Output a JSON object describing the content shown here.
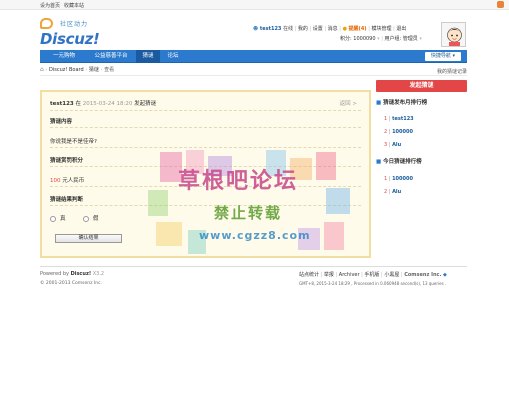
{
  "topbar": {
    "set_home": "设为首页",
    "bookmark": "收藏本站"
  },
  "logo": {
    "sub": "社区动力",
    "main": "Discuz!"
  },
  "user": {
    "name": "test123",
    "online": "在线",
    "links": [
      "我的",
      "设置",
      "消息"
    ],
    "reminder": "提醒(4)",
    "mod": "模块管理",
    "logout": "退出",
    "credits_label": "积分: 1000090",
    "group_label": "用户组: 管理员"
  },
  "nav": {
    "items": [
      "一元购物",
      "公益慈善平台",
      "猜谜",
      "论坛"
    ],
    "active_index": 2,
    "quick": "快捷导航 ▾"
  },
  "breadcrumb": {
    "home": "Discuz! Board",
    "section": "猜谜",
    "page": "查看"
  },
  "my_records": "我的猜谜记录",
  "post": {
    "author": "test123",
    "at": "在",
    "datetime": "2015-03-24 18:20",
    "action": "发起猜谜",
    "back": "返回 >",
    "content_title": "猜谜内容",
    "content": "你说我是不是佳帝?",
    "reward_title": "猜谜赏罚积分",
    "reward_value": "100",
    "reward_unit": "元人民币",
    "judge_title": "猜谜结果判断",
    "option_true": "真",
    "option_false": "假",
    "submit": "确认结果"
  },
  "sidebar": {
    "launch": "发起猜谜",
    "month_title": "猜谜发布月排行榜",
    "month_list": [
      {
        "rank": "1",
        "name": "test123"
      },
      {
        "rank": "2",
        "name": "100000"
      },
      {
        "rank": "3",
        "name": "Alu"
      }
    ],
    "today_title": "今日猜谜排行榜",
    "today_list": [
      {
        "rank": "1",
        "name": "100000"
      },
      {
        "rank": "2",
        "name": "Alu"
      }
    ]
  },
  "watermark": {
    "line1": "草根吧论坛",
    "line2": "禁止转载",
    "line3": "www.cgzz8.com"
  },
  "footer": {
    "powered": "Powered by",
    "brand": "Discuz!",
    "version": "X3.2",
    "copyright": "© 2001-2013 Comsenz Inc.",
    "links": [
      "站点统计",
      "举报",
      "Archiver",
      "手机版",
      "小黑屋"
    ],
    "company": "Comsenz Inc.",
    "time_info": "GMT+8, 2015-3-24 18:29 , Processed in 0.060948 second(s), 13 queries ."
  },
  "colors": {
    "nav": "#2b7acd",
    "accent_red": "#e24646",
    "card_bg": "#fffbea",
    "link": "#185c9c"
  }
}
